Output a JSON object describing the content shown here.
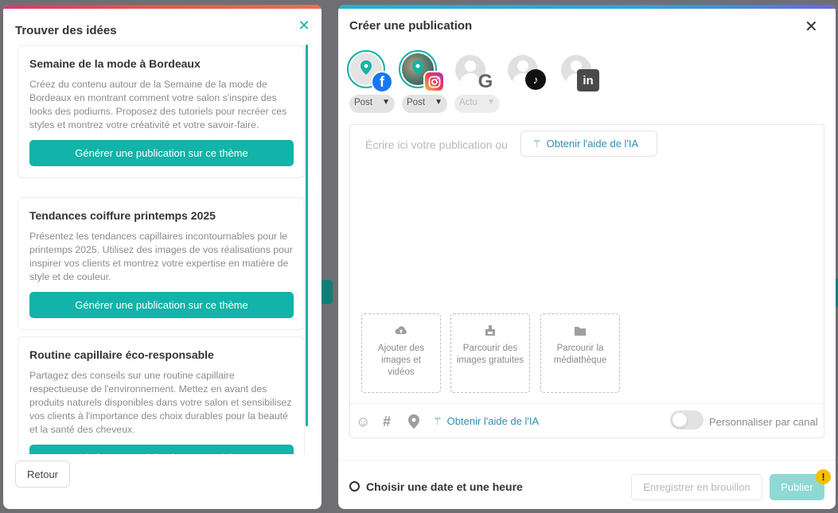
{
  "ideas_panel": {
    "title": "Trouver des idées",
    "close_icon": "close-icon",
    "accent_color": "#12b3a8",
    "ideas": [
      {
        "title": "Semaine de la mode à Bordeaux",
        "text": "Créez du contenu autour de la Semaine de la mode de Bordeaux en montrant comment votre salon s'inspire des looks des podiums. Proposez des tutoriels pour recréer ces styles et montrez votre créativité et votre savoir-faire.",
        "button": "Générer une publication sur ce thème"
      },
      {
        "title": "Tendances coiffure printemps 2025",
        "text": "Présentez les tendances capillaires incontournables pour le printemps 2025. Utilisez des images de vos réalisations pour inspirer vos clients et montrez votre expertise en matière de style et de couleur.",
        "button": "Générer une publication sur ce thème"
      },
      {
        "title": "Routine capillaire éco-responsable",
        "text": "Partagez des conseils sur une routine capillaire respectueuse de l'environnement. Mettez en avant des produits naturels disponibles dans votre salon et sensibilisez vos clients à l'importance des choix durables pour la beauté et la santé des cheveux.",
        "button": "Générer une publication sur ce thème"
      }
    ],
    "back_button": "Retour"
  },
  "composer": {
    "title": "Créer une publication",
    "close_icon": "close-icon",
    "accounts": [
      {
        "network": "facebook",
        "icon": "facebook-icon",
        "selected": true
      },
      {
        "network": "instagram",
        "icon": "instagram-icon",
        "selected": true
      },
      {
        "network": "google",
        "icon": "google-icon",
        "selected": false
      },
      {
        "network": "tiktok",
        "icon": "tiktok-icon",
        "selected": false
      },
      {
        "network": "linkedin",
        "icon": "linkedin-icon",
        "selected": false
      }
    ],
    "post_types": [
      {
        "label": "Post",
        "enabled": true
      },
      {
        "label": "Post",
        "enabled": true
      },
      {
        "label": "Actu",
        "enabled": false
      }
    ],
    "editor": {
      "placeholder": "Écrire ici votre publication ou",
      "ai_button": "Obtenir l'aide de l'IA"
    },
    "media": [
      {
        "label": "Ajouter des images et vidéos",
        "icon": "cloud-upload-icon"
      },
      {
        "label": "Parcourir des images gratuites",
        "icon": "image-library-icon"
      },
      {
        "label": "Parcourir la médiathèque",
        "icon": "folder-icon"
      }
    ],
    "toolbar": {
      "emoji_icon": "emoji-icon",
      "hashtag_icon": "hashtag-icon",
      "location_icon": "location-pin-icon",
      "ai_link": "Obtenir l'aide de l'IA",
      "toggle_label": "Personnaliser par canal",
      "toggle_on": false
    },
    "footer": {
      "schedule": "Choisir une date et une heure",
      "draft_button": "Enregistrer en brouillon",
      "publish_button": "Publier",
      "warning_badge": "!"
    },
    "colors": {
      "accent": "#12b3a8",
      "link": "#2e8fb5",
      "publish_disabled": "#8fd9d3",
      "warning": "#f5c000"
    }
  }
}
